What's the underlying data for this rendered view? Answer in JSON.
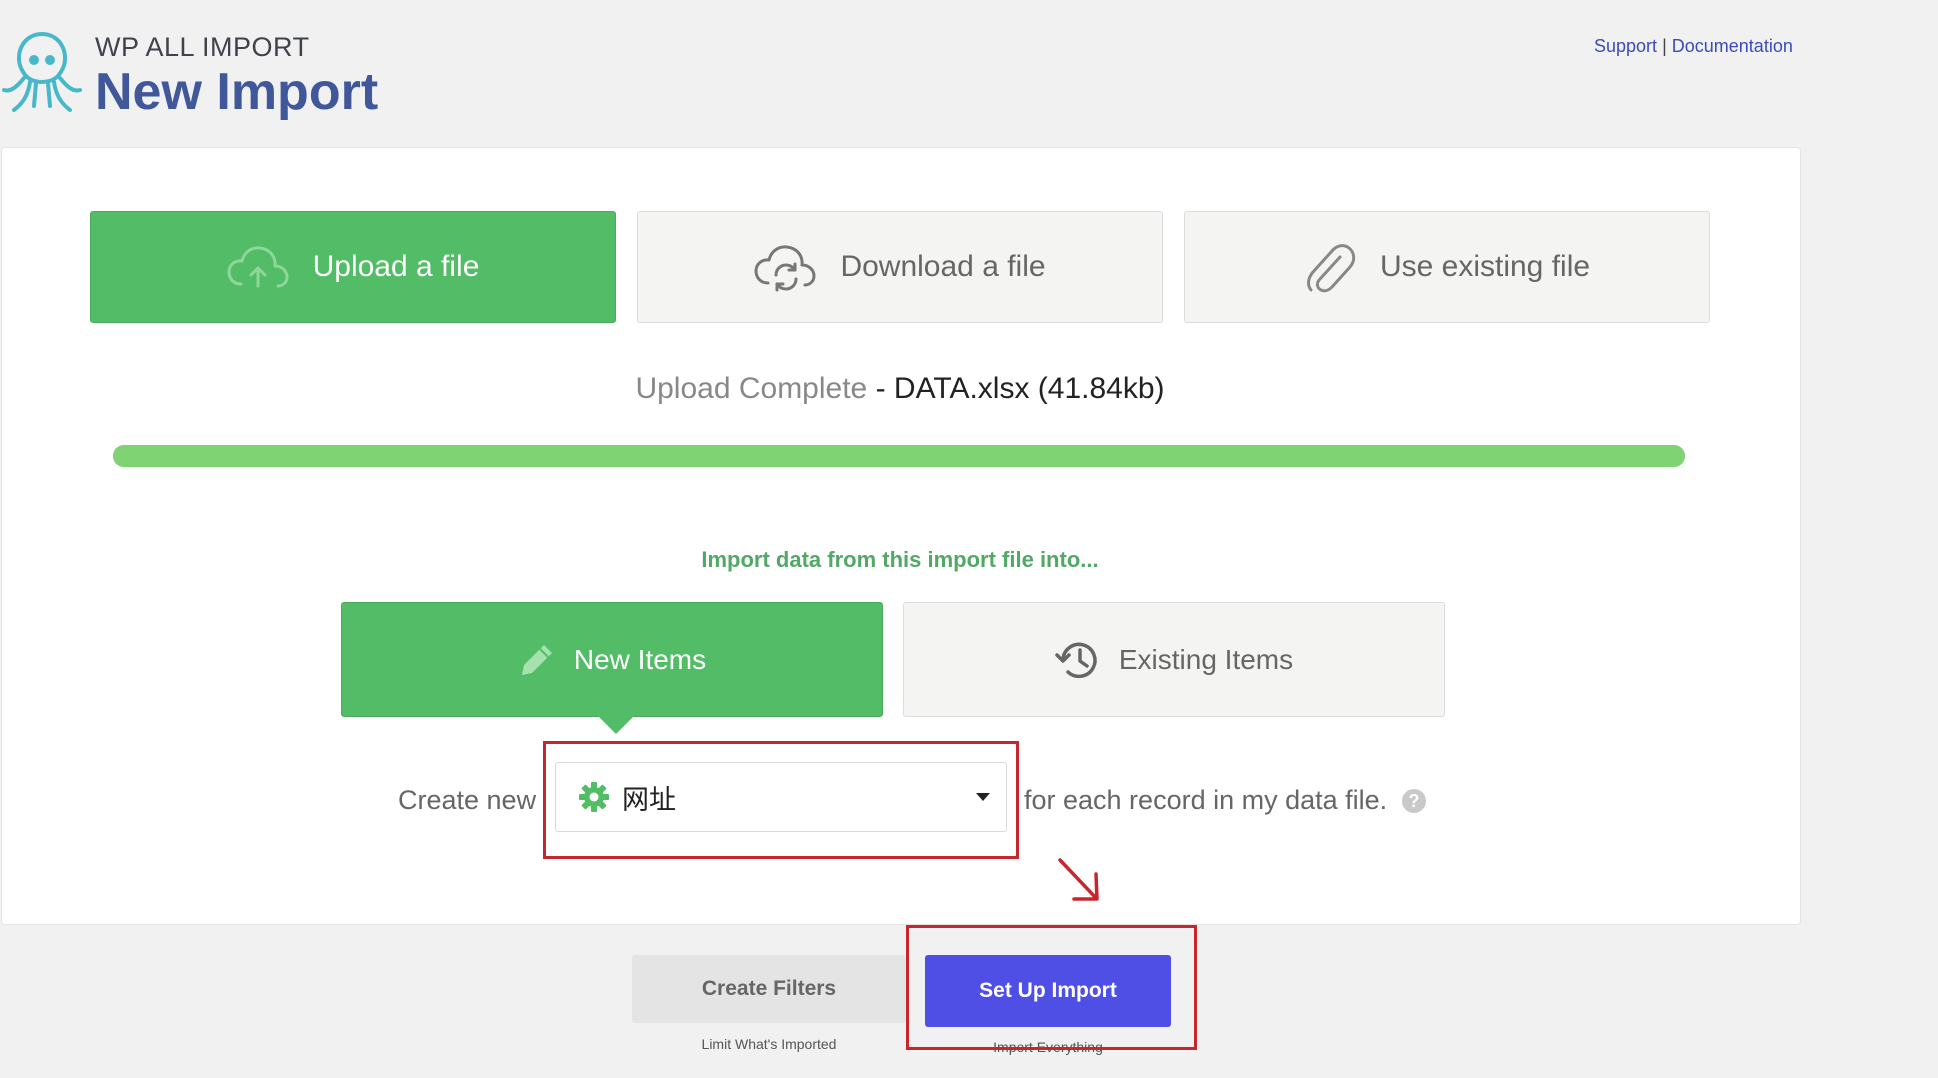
{
  "header": {
    "brand": "WP ALL IMPORT",
    "title": "New Import",
    "support_link": "Support",
    "separator": "|",
    "documentation_link": "Documentation"
  },
  "source_tabs": [
    {
      "label": "Upload a file",
      "icon": "cloud-upload-icon",
      "active": true
    },
    {
      "label": "Download a file",
      "icon": "cloud-sync-icon",
      "active": false
    },
    {
      "label": "Use existing file",
      "icon": "paperclip-icon",
      "active": false
    }
  ],
  "upload": {
    "status": "Upload Complete",
    "dash": " - ",
    "file": "DATA.xlsx (41.84kb)",
    "progress": 1.0
  },
  "import_into": {
    "heading": "Import data from this import file into...",
    "new_items": "New Items",
    "existing_items": "Existing Items",
    "create_new_label": "Create new",
    "selected_post_type": "网址",
    "for_each_label": "for each record in my data file.",
    "help": "?"
  },
  "actions": {
    "create_filters": "Create Filters",
    "create_filters_sub": "Limit What's Imported",
    "setup_import": "Set Up Import",
    "setup_import_sub": "Import Everything"
  },
  "colors": {
    "accent_green": "#52bd66",
    "progress_green": "#7fd373",
    "primary_button": "#4f4fe5",
    "annotation_red": "#c9252f",
    "title_blue": "#40589a"
  }
}
